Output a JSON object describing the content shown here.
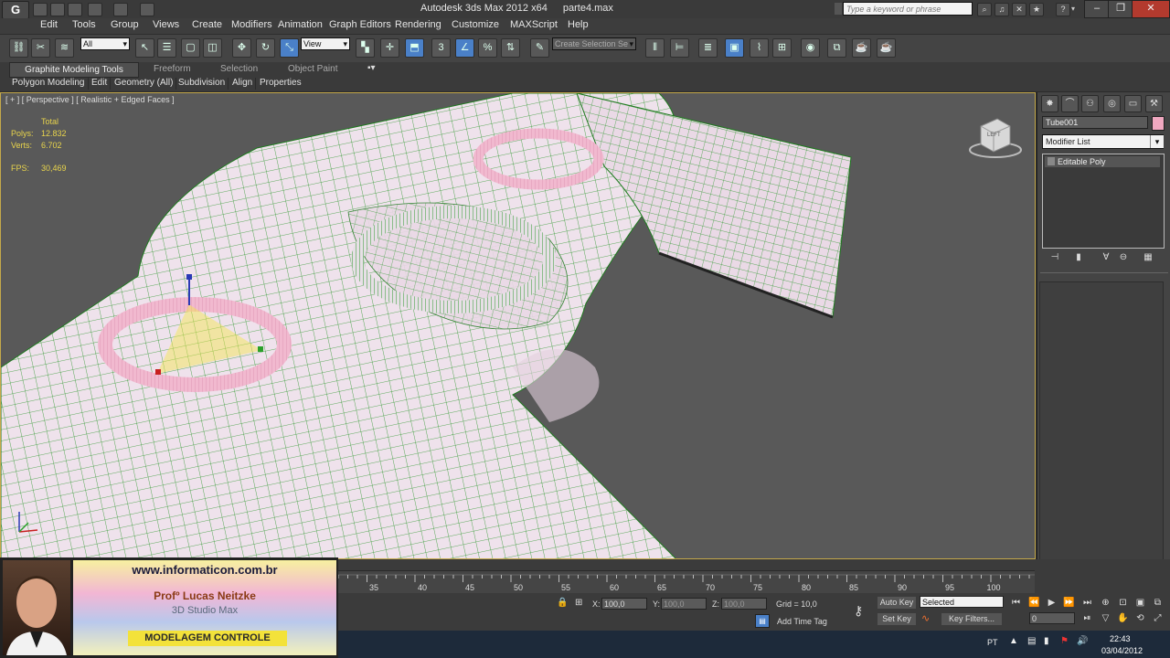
{
  "titlebar": {
    "app_title": "Autodesk 3ds Max  2012 x64",
    "file_name": "parte4.max",
    "search_placeholder": "Type a keyword or phrase",
    "logo_letter": "G"
  },
  "menubar": {
    "items": [
      "Edit",
      "Tools",
      "Group",
      "Views",
      "Create",
      "Modifiers",
      "Animation",
      "Graph Editors",
      "Rendering",
      "Customize",
      "MAXScript",
      "Help"
    ]
  },
  "toolbar": {
    "selection_filter": "All",
    "reference_coord": "View",
    "named_selection_placeholder": "Create Selection Se",
    "snap_number": "3"
  },
  "ribbon": {
    "tabs": [
      "Graphite Modeling Tools",
      "Freeform",
      "Selection",
      "Object Paint"
    ],
    "groups": [
      "Polygon Modeling",
      "Edit",
      "Geometry (All)",
      "Subdivision",
      "Align",
      "Properties"
    ]
  },
  "viewport": {
    "label": "[ + ] [ Perspective ] [ Realistic + Edged Faces ]",
    "stats": {
      "total_label": "Total",
      "polys_label": "Polys:",
      "polys_value": "12.832",
      "verts_label": "Verts:",
      "verts_value": "6.702",
      "fps_label": "FPS:",
      "fps_value": "30,469"
    },
    "viewcube_face": "LEFT"
  },
  "command_panel": {
    "object_name": "Tube001",
    "object_color": "#f0a8c0",
    "modifier_list": "Modifier List",
    "modifier_stack": [
      "Editable Poly"
    ]
  },
  "timeline": {
    "ticks": [
      "35",
      "40",
      "45",
      "50",
      "55",
      "60",
      "65",
      "70",
      "75",
      "80",
      "85",
      "90",
      "95",
      "100"
    ]
  },
  "statusbar": {
    "x_label": "X:",
    "x_value": "100,0",
    "y_label": "Y:",
    "y_value": "100,0",
    "z_label": "Z:",
    "z_value": "100,0",
    "grid": "Grid = 10,0",
    "auto_key": "Auto Key",
    "selected": "Selected",
    "set_key": "Set Key",
    "key_filters": "Key Filters...",
    "add_time_tag": "Add Time Tag",
    "frame_value": "0"
  },
  "taskbar": {
    "language": "PT",
    "time": "22:43",
    "date": "03/04/2012"
  },
  "overlay": {
    "site": "www.informaticon.com.br",
    "professor": "Profº Lucas Neitzke",
    "course": "3D Studio Max",
    "badge": "MODELAGEM CONTROLE"
  }
}
